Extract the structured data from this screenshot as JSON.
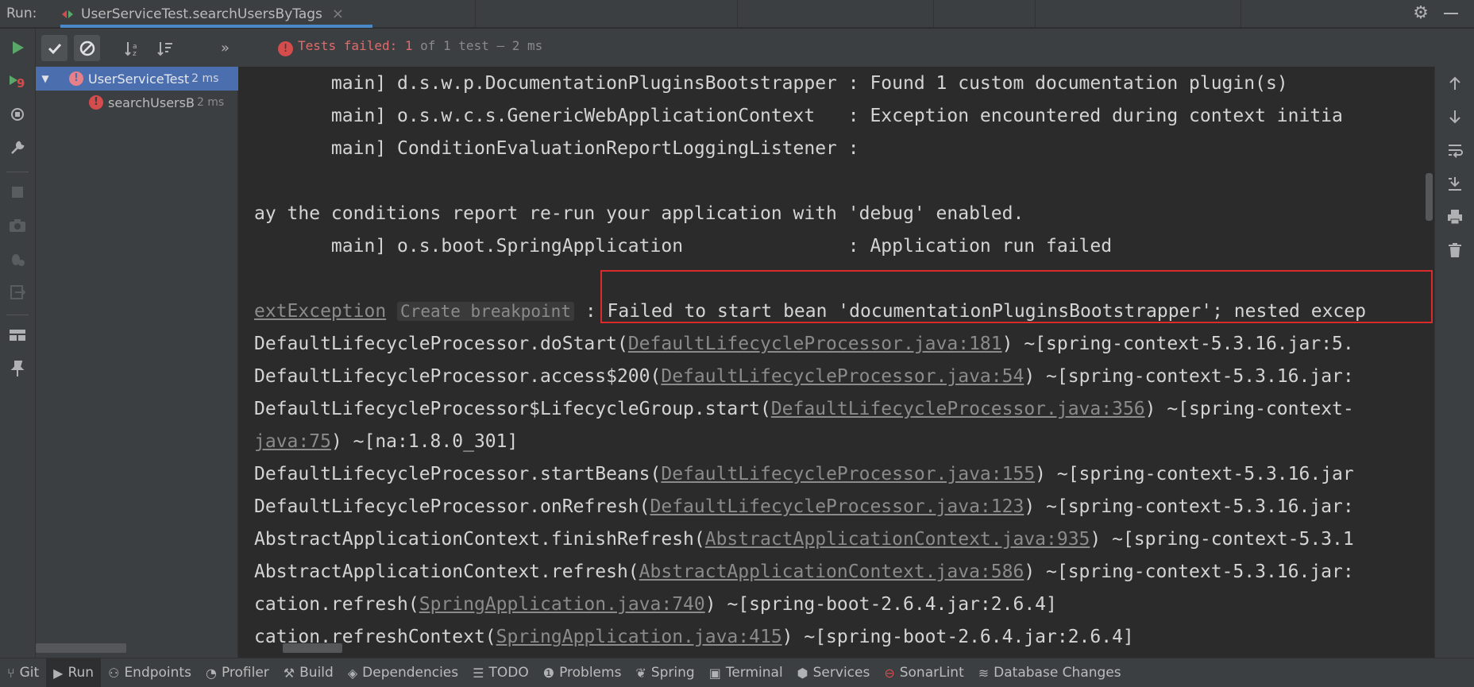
{
  "run_bar": {
    "label": "Run:",
    "tab_title": "UserServiceTest.searchUsersByTags",
    "close_glyph": "×"
  },
  "test_toolbar": {
    "status_failed": "Tests failed: 1",
    "status_rest": " of 1 test – 2 ms",
    "more_glyph": "»"
  },
  "tree": {
    "root": {
      "label": "UserServiceTest",
      "time": "2 ms"
    },
    "child": {
      "label": "searchUsersB",
      "time": "2 ms"
    }
  },
  "console": {
    "lines": [
      {
        "text": "       main] d.s.w.p.DocumentationPluginsBootstrapper : Found 1 custom documentation plugin(s)"
      },
      {
        "text": "       main] o.s.w.c.s.GenericWebApplicationContext   : Exception encountered during context initia"
      },
      {
        "text": "       main] ConditionEvaluationReportLoggingListener :"
      },
      {
        "text": ""
      },
      {
        "text": "ay the conditions report re-run your application with 'debug' enabled."
      },
      {
        "text": "       main] o.s.boot.SpringApplication               : Application run failed"
      },
      {
        "text": ""
      },
      {
        "pre": "",
        "exc": "extException",
        "hint": "Create breakpoint",
        "post": " : Failed to start bean 'documentationPluginsBootstrapper'; nested excep"
      },
      {
        "pre": "DefaultLifecycleProcessor.doStart(",
        "link": "DefaultLifecycleProcessor.java:181",
        "post": ") ~[spring-context-5.3.16.jar:5."
      },
      {
        "pre": "DefaultLifecycleProcessor.access$200(",
        "link": "DefaultLifecycleProcessor.java:54",
        "post": ") ~[spring-context-5.3.16.jar:"
      },
      {
        "pre": "DefaultLifecycleProcessor$LifecycleGroup.start(",
        "link": "DefaultLifecycleProcessor.java:356",
        "post": ") ~[spring-context-"
      },
      {
        "pre": "",
        "link": "java:75",
        "post": ") ~[na:1.8.0_301]"
      },
      {
        "pre": "DefaultLifecycleProcessor.startBeans(",
        "link": "DefaultLifecycleProcessor.java:155",
        "post": ") ~[spring-context-5.3.16.jar"
      },
      {
        "pre": "DefaultLifecycleProcessor.onRefresh(",
        "link": "DefaultLifecycleProcessor.java:123",
        "post": ") ~[spring-context-5.3.16.jar:"
      },
      {
        "pre": "AbstractApplicationContext.finishRefresh(",
        "link": "AbstractApplicationContext.java:935",
        "post": ") ~[spring-context-5.3.1"
      },
      {
        "pre": "AbstractApplicationContext.refresh(",
        "link": "AbstractApplicationContext.java:586",
        "post": ") ~[spring-context-5.3.16.jar:"
      },
      {
        "pre": "cation.refresh(",
        "link": "SpringApplication.java:740",
        "post": ") ~[spring-boot-2.6.4.jar:2.6.4]"
      },
      {
        "pre": "cation.refreshContext(",
        "link": "SpringApplication.java:415",
        "post": ") ~[spring-boot-2.6.4.jar:2.6.4]"
      }
    ]
  },
  "bottom_bar": {
    "items": [
      {
        "label": "Git",
        "icon": "git-branch-icon"
      },
      {
        "label": "Run",
        "icon": "run-icon",
        "active": true
      },
      {
        "label": "Endpoints",
        "icon": "endpoints-icon"
      },
      {
        "label": "Profiler",
        "icon": "profiler-icon"
      },
      {
        "label": "Build",
        "icon": "hammer-icon"
      },
      {
        "label": "Dependencies",
        "icon": "dependencies-icon"
      },
      {
        "label": "TODO",
        "icon": "todo-list-icon"
      },
      {
        "label": "Problems",
        "icon": "problems-icon"
      },
      {
        "label": "Spring",
        "icon": "spring-leaf-icon"
      },
      {
        "label": "Terminal",
        "icon": "terminal-icon"
      },
      {
        "label": "Services",
        "icon": "services-icon"
      },
      {
        "label": "SonarLint",
        "icon": "sonarlint-icon"
      },
      {
        "label": "Database Changes",
        "icon": "database-icon"
      }
    ]
  },
  "colors": {
    "accent": "#4a88c7",
    "error": "#d44c4c",
    "run_green": "#59a869",
    "highlight_border": "#d92b2b"
  }
}
